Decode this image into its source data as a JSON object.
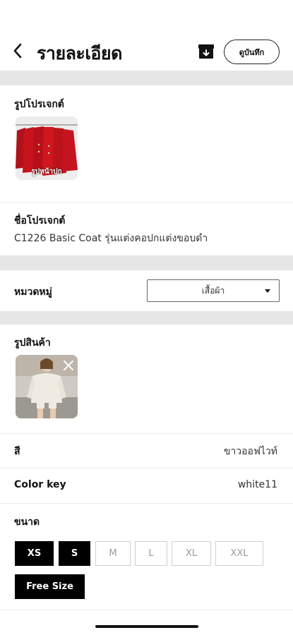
{
  "header": {
    "title": "รายละเอียด",
    "view_button": "ดูบันทึก"
  },
  "project_image": {
    "label": "รูปโปรเจกต์",
    "caption": "รูปหน้าปก"
  },
  "project_name": {
    "label": "ชื่อโปรเจกต์",
    "value": "C1226 Basic Coat รุ่นแต่งคอปกแต่งขอบดำ"
  },
  "category": {
    "label": "หมวดหมู่",
    "selected": "เสื้อผ้า"
  },
  "product_image": {
    "label": "รูปสินค้า"
  },
  "color": {
    "label": "สี",
    "value": "ขาวออฟไวท์"
  },
  "color_key": {
    "label": "Color key",
    "value": "white11"
  },
  "size": {
    "label": "ขนาด",
    "options": [
      {
        "label": "XS",
        "selected": true
      },
      {
        "label": "S",
        "selected": true
      },
      {
        "label": "M",
        "selected": false
      },
      {
        "label": "L",
        "selected": false
      },
      {
        "label": "XL",
        "selected": false
      },
      {
        "label": "XXL",
        "selected": false
      },
      {
        "label": "Free Size",
        "selected": true
      }
    ]
  },
  "colors": {
    "selected_bg": "#000000",
    "separator": "#e6e6e6",
    "coat_red": "#c8141c"
  }
}
